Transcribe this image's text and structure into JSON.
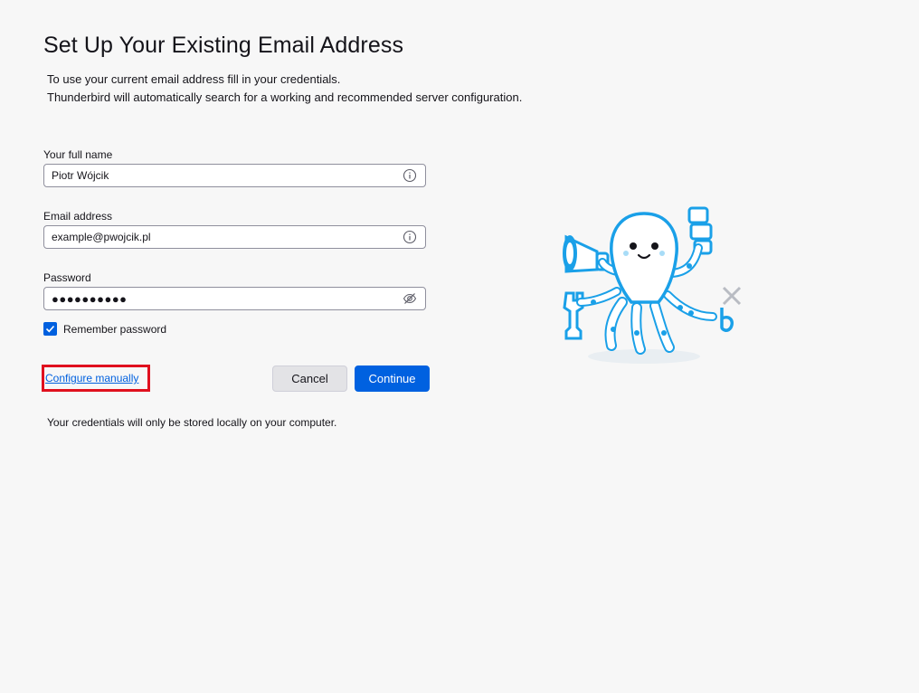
{
  "header": {
    "title": "Set Up Your Existing Email Address",
    "subtitle_line1": "To use your current email address fill in your credentials.",
    "subtitle_line2": "Thunderbird will automatically search for a working and recommended server configuration."
  },
  "form": {
    "full_name": {
      "label": "Your full name",
      "value": "Piotr Wójcik",
      "icon": "info-icon"
    },
    "email": {
      "label": "Email address",
      "value": "example@pwojcik.pl",
      "icon": "info-icon"
    },
    "password": {
      "label": "Password",
      "masked_value": "●●●●●●●●●●",
      "icon": "eye-slash-icon"
    },
    "remember_password": {
      "label": "Remember password",
      "checked": true
    }
  },
  "actions": {
    "configure_manually": "Configure manually",
    "cancel": "Cancel",
    "continue": "Continue"
  },
  "footnote": "Your credentials will only be stored locally on your computer.",
  "colors": {
    "accent": "#0060df",
    "highlight_border": "#e0101e",
    "background": "#f7f7f7",
    "mascot_blue": "#1aa0e8"
  }
}
